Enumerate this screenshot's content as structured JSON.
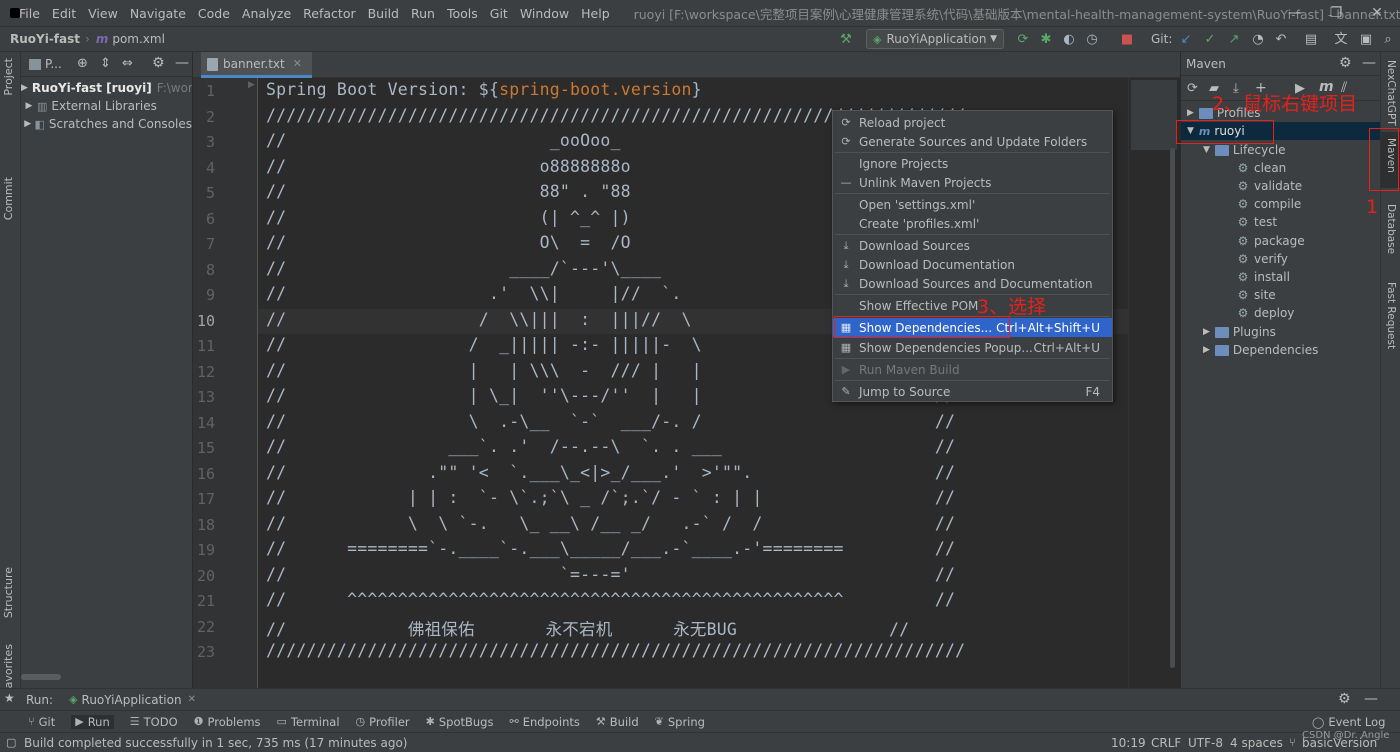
{
  "window": {
    "menu": [
      "File",
      "Edit",
      "View",
      "Navigate",
      "Code",
      "Analyze",
      "Refactor",
      "Build",
      "Run",
      "Tools",
      "Git",
      "Window",
      "Help"
    ],
    "title": "ruoyi [F:\\workspace\\完整项目案例\\心理健康管理系统\\代码\\基础版本\\mental-health-management-system\\RuoYi-fast] - banner.txt",
    "controls": [
      "—",
      "❐",
      "✕"
    ]
  },
  "navbar": {
    "project": "RuoYi-fast",
    "file": "pom.xml",
    "run_config": "RuoYiApplication",
    "git_label": "Git:"
  },
  "left_strip": {
    "project": "Project",
    "commit": "Commit",
    "structure": "Structure",
    "favorites": "Favorites"
  },
  "project_panel": {
    "header": "P...",
    "tree": [
      {
        "label": "RuoYi-fast [ruoyi]",
        "hint": "F:\\worl"
      },
      {
        "label": "External Libraries",
        "hint": ""
      },
      {
        "label": "Scratches and Consoles",
        "hint": ""
      }
    ]
  },
  "editor": {
    "tab": "banner.txt",
    "line_numbers": [
      "1",
      "2",
      "3",
      "4",
      "5",
      "6",
      "7",
      "8",
      "9",
      "10",
      "11",
      "12",
      "13",
      "14",
      "15",
      "16",
      "17",
      "18",
      "19",
      "20",
      "21",
      "22",
      "23"
    ],
    "current_line": "10",
    "line1_prefix": "Spring Boot Version: ${",
    "line1_var": "spring-boot.version",
    "line1_suffix": "}",
    "lines": [
      "/////////////////////////////////////////////////////////////////////",
      "//                          _ooOoo_                               //",
      "//                         o8888888o                              //",
      "//                         88\" . \"88                              //",
      "//                         (| ^_^ |)                              //",
      "//                         O\\  =  /O                              //",
      "//                      ____/`---'\\____                           //",
      "//                    .'  \\\\|     |//  `.                         //",
      "//                   /  \\\\|||  :  |||//  \\                        //",
      "//                  /  _||||| -:- |||||-  \\                       //",
      "//                  |   | \\\\\\  -  /// |   |                       //",
      "//                  | \\_|  ''\\---/''  |   |                       //",
      "//                  \\  .-\\__  `-`  ___/-. /                       //",
      "//                ___`. .'  /--.--\\  `. . ___                     //",
      "//              .\"\" '<  `.___\\_<|>_/___.'  >'\"\".                  //",
      "//            | | :  `- \\`.;`\\ _ /`;.`/ - ` : | |                 //",
      "//            \\  \\ `-.   \\_ __\\ /__ _/   .-` /  /                 //",
      "//      ========`-.____`-.___\\_____/___.-`____.-'========         //",
      "//                           `=---='                              //",
      "//      ^^^^^^^^^^^^^^^^^^^^^^^^^^^^^^^^^^^^^^^^^^^^^^^^^         //",
      "//            佛祖保佑       永不宕机      永无BUG               //",
      "/////////////////////////////////////////////////////////////////////"
    ]
  },
  "context_menu": {
    "items": [
      {
        "icon": "⟳",
        "label": "Reload project",
        "shortcut": ""
      },
      {
        "icon": "⟳",
        "label": "Generate Sources and Update Folders",
        "shortcut": ""
      },
      {
        "icon": "",
        "label": "Ignore Projects",
        "shortcut": ""
      },
      {
        "icon": "—",
        "label": "Unlink Maven Projects",
        "shortcut": ""
      },
      {
        "icon": "",
        "label": "Open 'settings.xml'",
        "shortcut": ""
      },
      {
        "icon": "",
        "label": "Create 'profiles.xml'",
        "shortcut": ""
      },
      {
        "icon": "⤓",
        "label": "Download Sources",
        "shortcut": ""
      },
      {
        "icon": "⤓",
        "label": "Download Documentation",
        "shortcut": ""
      },
      {
        "icon": "⤓",
        "label": "Download Sources and Documentation",
        "shortcut": ""
      },
      {
        "icon": "",
        "label": "Show Effective POM",
        "shortcut": ""
      },
      {
        "icon": "▦",
        "label": "Show Dependencies...",
        "shortcut": "Ctrl+Alt+Shift+U"
      },
      {
        "icon": "▦",
        "label": "Show Dependencies Popup...",
        "shortcut": "Ctrl+Alt+U"
      },
      {
        "icon": "▶",
        "label": "Run Maven Build",
        "shortcut": ""
      },
      {
        "icon": "✎",
        "label": "Jump to Source",
        "shortcut": "F4"
      }
    ]
  },
  "maven": {
    "title": "Maven",
    "profiles": "Profiles",
    "project": "ruoyi",
    "lifecycle": "Lifecycle",
    "goals": [
      "clean",
      "validate",
      "compile",
      "test",
      "package",
      "verify",
      "install",
      "site",
      "deploy"
    ],
    "plugins": "Plugins",
    "dependencies": "Dependencies"
  },
  "right_strip": {
    "nexchat": "NexChatGPT",
    "maven": "Maven",
    "database": "Database",
    "fast_request": "Fast Request"
  },
  "annotations": {
    "step1": "1",
    "step2": "2、鼠标右键项目",
    "step3": "3、选择"
  },
  "run_bar": {
    "label": "Run:",
    "config": "RuoYiApplication"
  },
  "tool_windows": [
    "Git",
    "Run",
    "TODO",
    "Problems",
    "Terminal",
    "Profiler",
    "SpotBugs",
    "Endpoints",
    "Build",
    "Spring"
  ],
  "event_log": "Event Log",
  "status": {
    "message": "Build completed successfully in 1 sec, 735 ms (17 minutes ago)",
    "position": "10:19",
    "line_sep": "CRLF",
    "encoding": "UTF-8",
    "indent": "4 spaces",
    "branch": "basicVersion",
    "watermark": "CSDN @Dr. Angle"
  }
}
